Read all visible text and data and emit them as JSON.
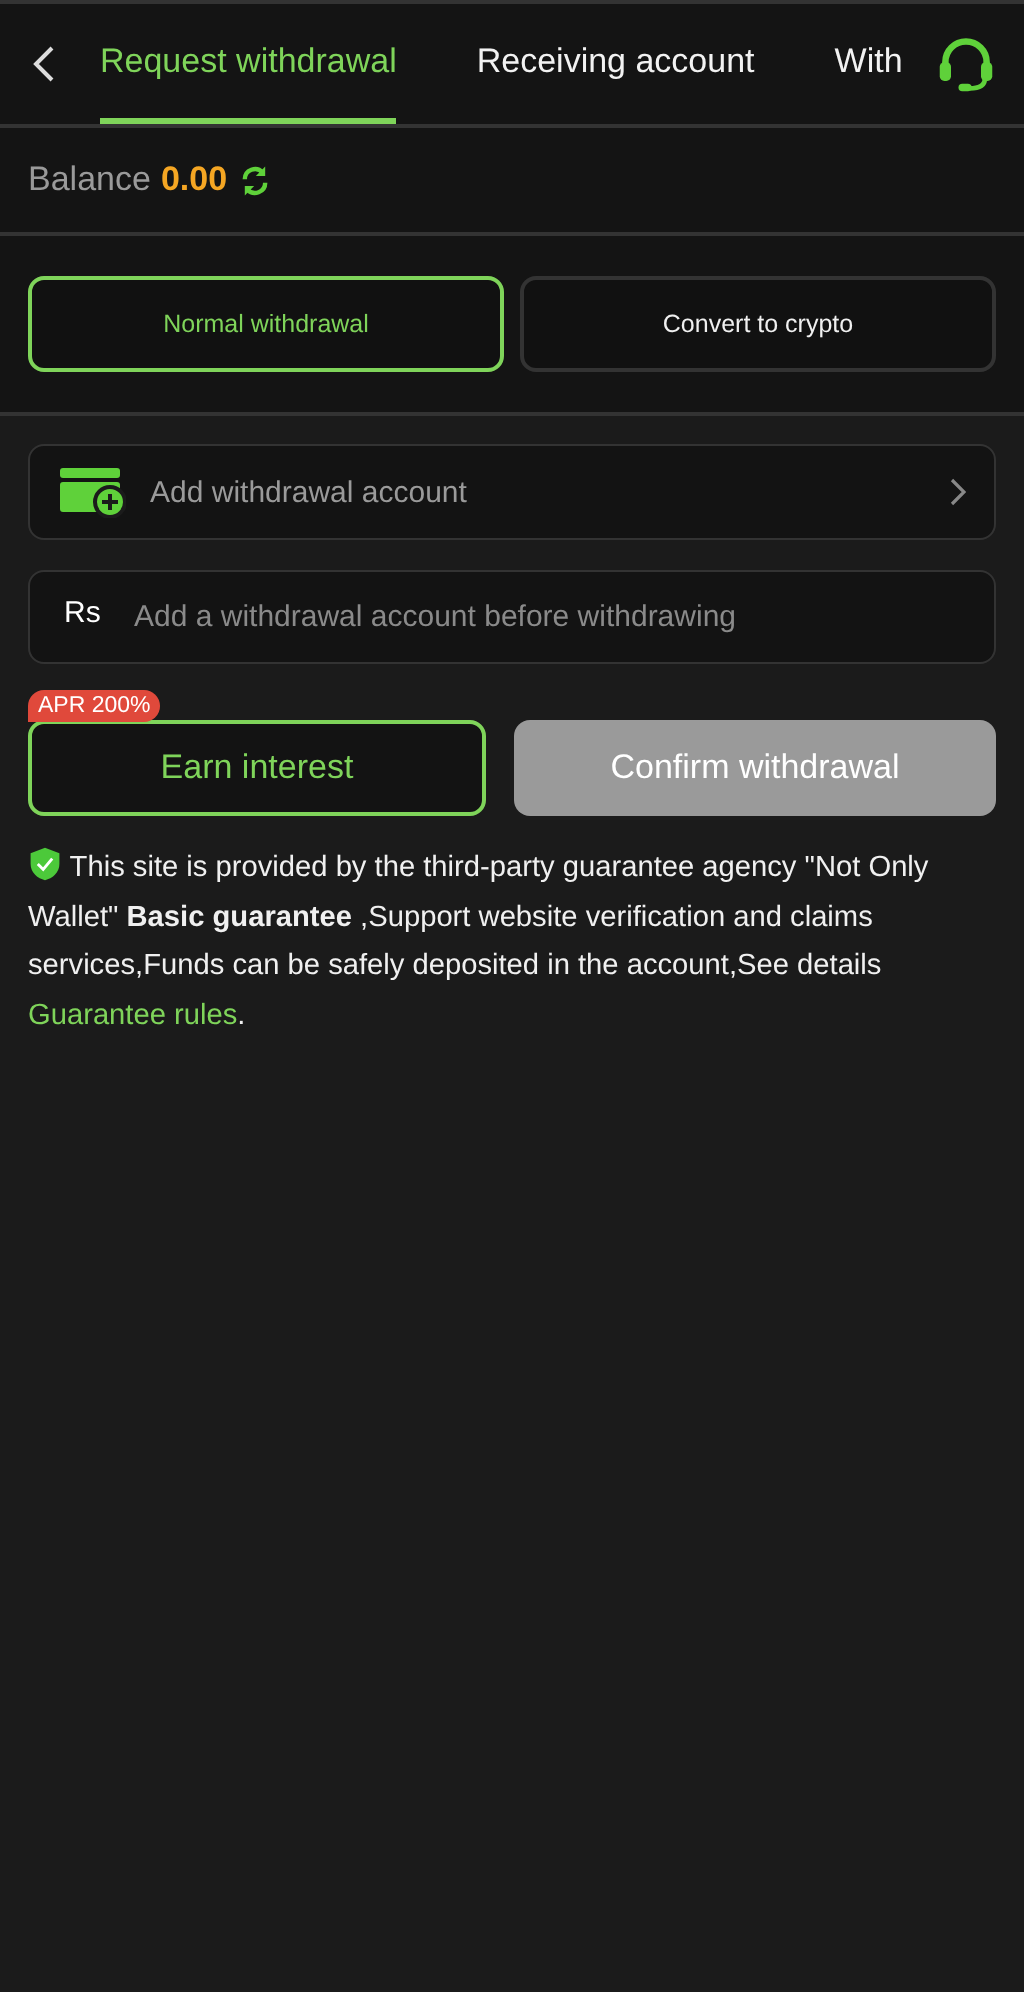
{
  "tabs": [
    {
      "label": "Request withdrawal",
      "selected": true
    },
    {
      "label": "Receiving account",
      "selected": false
    },
    {
      "label": "With",
      "selected": false
    }
  ],
  "balance": {
    "label": "Balance",
    "amount": "0.00"
  },
  "modes": [
    {
      "label": "Normal withdrawal",
      "selected": true
    },
    {
      "label": "Convert to crypto",
      "selected": false
    }
  ],
  "account_row": {
    "label": "Add withdrawal account"
  },
  "amount_field": {
    "currency": "Rs",
    "placeholder": "Add a withdrawal account before withdrawing"
  },
  "earn_button": {
    "label": "Earn interest",
    "badge": "APR 200%"
  },
  "confirm_button": {
    "label": "Confirm withdrawal",
    "disabled": true
  },
  "notice": {
    "text": "This site is provided by the third-party guarantee agency \"Not Only Wallet\" **Basic guarantee** ,Support website verification and claims services,Funds can be safely deposited in the account,See details",
    "link": "Guarantee rules",
    "end": "."
  }
}
